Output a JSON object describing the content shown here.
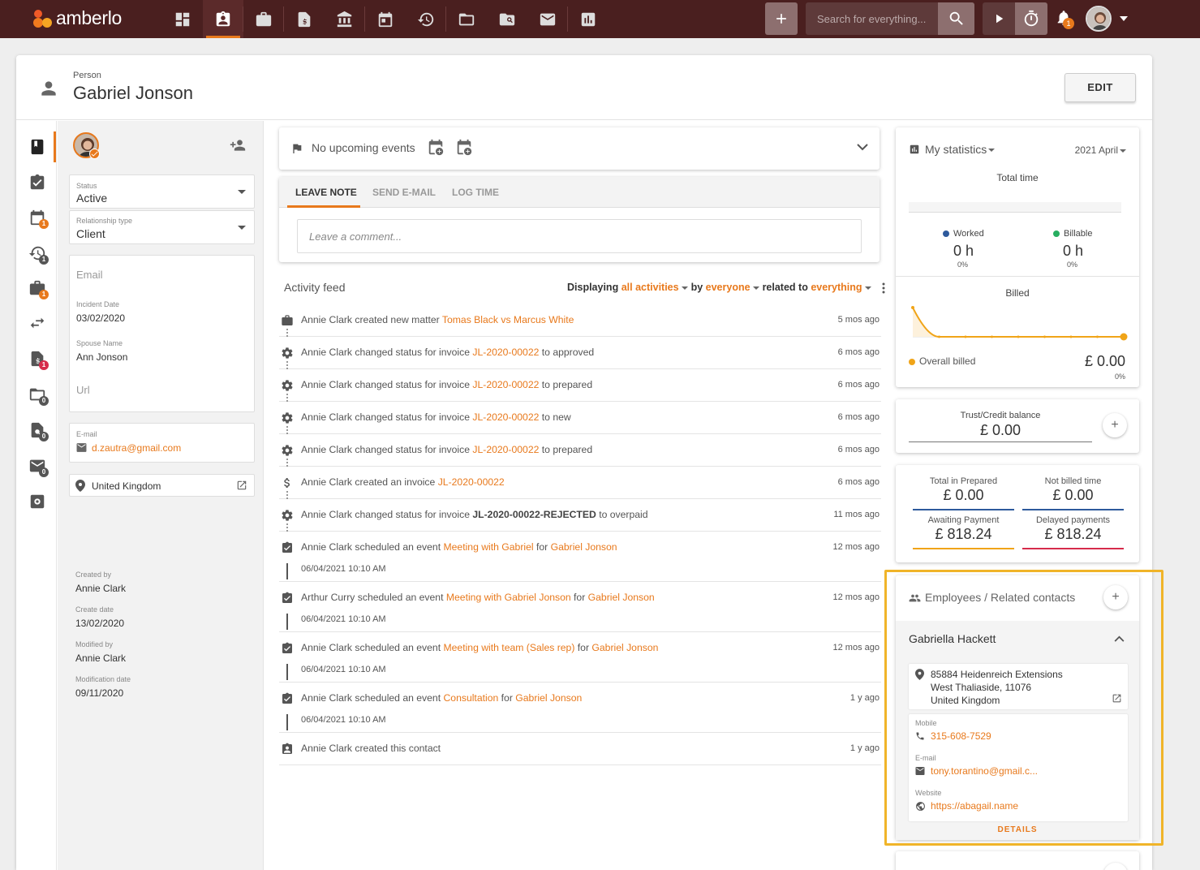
{
  "brand": {
    "name": "amberlo",
    "accent": "#e8791c",
    "topbar_color": "#4a1f1f"
  },
  "topbar": {
    "nav_icons": [
      "dashboard-icon",
      "contacts-icon",
      "matters-icon",
      "invoice-icon",
      "bank-icon",
      "calendar-icon",
      "time-history-icon",
      "folder-icon",
      "document-search-icon",
      "mail-icon",
      "reports-icon"
    ],
    "search_placeholder": "Search for everything...",
    "notification_count": "1"
  },
  "header": {
    "entity_type": "Person",
    "name": "Gabriel Jonson",
    "edit_label": "EDIT"
  },
  "rail": {
    "badges": {
      "calendar": "1",
      "time": "1",
      "matters": "1",
      "invoices": "1",
      "documents": "0",
      "doc_search": "0",
      "mail": "0"
    }
  },
  "left": {
    "status_label": "Status",
    "status_value": "Active",
    "relationship_label": "Relationship type",
    "relationship_value": "Client",
    "email_placeholder": "Email",
    "incident_date_label": "Incident Date",
    "incident_date": "03/02/2020",
    "spouse_label": "Spouse Name",
    "spouse": "Ann Jonson",
    "url_placeholder": "Url",
    "email_label": "E-mail",
    "email": "d.zautra@gmail.com",
    "country": "United Kingdom",
    "created_by_label": "Created by",
    "created_by": "Annie Clark",
    "create_date_label": "Create date",
    "create_date": "13/02/2020",
    "modified_by_label": "Modified by",
    "modified_by": "Annie Clark",
    "modification_date_label": "Modification date",
    "modification_date": "09/11/2020"
  },
  "events": {
    "text": "No upcoming events"
  },
  "note": {
    "tabs": [
      "LEAVE NOTE",
      "SEND E-MAIL",
      "LOG TIME"
    ],
    "placeholder": "Leave a comment..."
  },
  "feed": {
    "title": "Activity feed",
    "filter_prefix": "Displaying",
    "filter_what": "all activities",
    "filter_by": "by",
    "filter_who": "everyone",
    "filter_related": "related to",
    "filter_scope": "everything",
    "rows": [
      {
        "icon": "briefcase-icon",
        "actor": "Annie Clark",
        "action": "created new matter",
        "link": "Tomas Black vs Marcus White",
        "after": "",
        "sub": "",
        "ago": "5 mos ago"
      },
      {
        "icon": "gear-icon",
        "actor": "Annie Clark",
        "action": "changed status for invoice",
        "link": "JL-2020-00022",
        "after": "to approved",
        "sub": "",
        "ago": "6 mos ago"
      },
      {
        "icon": "gear-icon",
        "actor": "Annie Clark",
        "action": "changed status for invoice",
        "link": "JL-2020-00022",
        "after": "to prepared",
        "sub": "",
        "ago": "6 mos ago"
      },
      {
        "icon": "gear-icon",
        "actor": "Annie Clark",
        "action": "changed status for invoice",
        "link": "JL-2020-00022",
        "after": "to new",
        "sub": "",
        "ago": "6 mos ago"
      },
      {
        "icon": "gear-icon",
        "actor": "Annie Clark",
        "action": "changed status for invoice",
        "link": "JL-2020-00022",
        "after": "to prepared",
        "sub": "",
        "ago": "6 mos ago"
      },
      {
        "icon": "dollar-icon",
        "actor": "Annie Clark",
        "action": "created an invoice",
        "link": "JL-2020-00022",
        "after": "",
        "sub": "",
        "ago": "6 mos ago"
      },
      {
        "icon": "gear-icon",
        "actor": "Annie Clark",
        "action": "changed status for invoice",
        "bold": "JL-2020-00022-REJECTED",
        "after": "to overpaid",
        "sub": "",
        "ago": "11 mos ago"
      },
      {
        "icon": "event-check-icon",
        "actor": "Annie Clark",
        "action": "scheduled an event",
        "link": "Meeting with Gabriel",
        "for": "for",
        "link2": "Gabriel Jonson",
        "sub": "06/04/2021 10:10 AM",
        "ago": "12 mos ago"
      },
      {
        "icon": "event-check-icon",
        "actor": "Arthur Curry",
        "action": "scheduled an event",
        "link": "Meeting with Gabriel Jonson",
        "for": "for",
        "link2": "Gabriel Jonson",
        "sub": "06/04/2021 10:10 AM",
        "ago": "12 mos ago"
      },
      {
        "icon": "event-check-icon",
        "actor": "Annie Clark",
        "action": "scheduled an event",
        "link": "Meeting with team (Sales rep)",
        "for": "for",
        "link2": "Gabriel Jonson",
        "sub": "06/04/2021 10:10 AM",
        "ago": "12 mos ago"
      },
      {
        "icon": "event-check-icon",
        "actor": "Annie Clark",
        "action": "scheduled an event",
        "link": "Consultation",
        "for": "for",
        "link2": "Gabriel Jonson",
        "sub": "06/04/2021 10:10 AM",
        "ago": "1 y ago"
      },
      {
        "icon": "contact-icon",
        "actor": "Annie Clark",
        "action": "created this contact",
        "link": "",
        "after": "",
        "sub": "",
        "ago": "1 y ago"
      }
    ]
  },
  "stats": {
    "title": "My statistics",
    "period": "2021 April",
    "total_time_label": "Total time",
    "worked_label": "Worked",
    "worked_value": "0 h",
    "worked_pct": "0%",
    "worked_color": "#2e5a9c",
    "billable_label": "Billable",
    "billable_value": "0 h",
    "billable_pct": "0%",
    "billable_color": "#27ae60",
    "billed_label": "Billed",
    "overall_billed_label": "Overall billed",
    "overall_billed_value": "£ 0.00",
    "overall_billed_pct": "0%",
    "billed_color": "#f0a418"
  },
  "chart_data": {
    "type": "line",
    "title": "Billed",
    "series": [
      {
        "name": "Overall billed",
        "values": [
          1,
          0,
          0,
          0,
          0,
          0,
          0,
          0,
          0
        ]
      }
    ]
  },
  "trust": {
    "label": "Trust/Credit balance",
    "value": "£ 0.00"
  },
  "totals": {
    "prepared_label": "Total in Prepared",
    "prepared_value": "£ 0.00",
    "prepared_color": "#2e5a9c",
    "not_billed_label": "Not billed time",
    "not_billed_value": "£ 0.00",
    "not_billed_color": "#2e5a9c",
    "awaiting_label": "Awaiting Payment",
    "awaiting_value": "£ 818.24",
    "awaiting_color": "#f0a418",
    "delayed_label": "Delayed payments",
    "delayed_value": "£ 818.24",
    "delayed_color": "#d62b4b"
  },
  "employees": {
    "title": "Employees / Related contacts",
    "contact_name": "Gabriella Hackett",
    "address_line1": "85884 Heidenreich Extensions",
    "address_line2": "West Thaliaside, 11076",
    "address_line3": "United Kingdom",
    "mobile_label": "Mobile",
    "mobile": "315-608-7529",
    "email_label": "E-mail",
    "email": "tony.torantino@gmail.c...",
    "website_label": "Website",
    "website": "https://abagail.name",
    "details_label": "DETAILS"
  }
}
